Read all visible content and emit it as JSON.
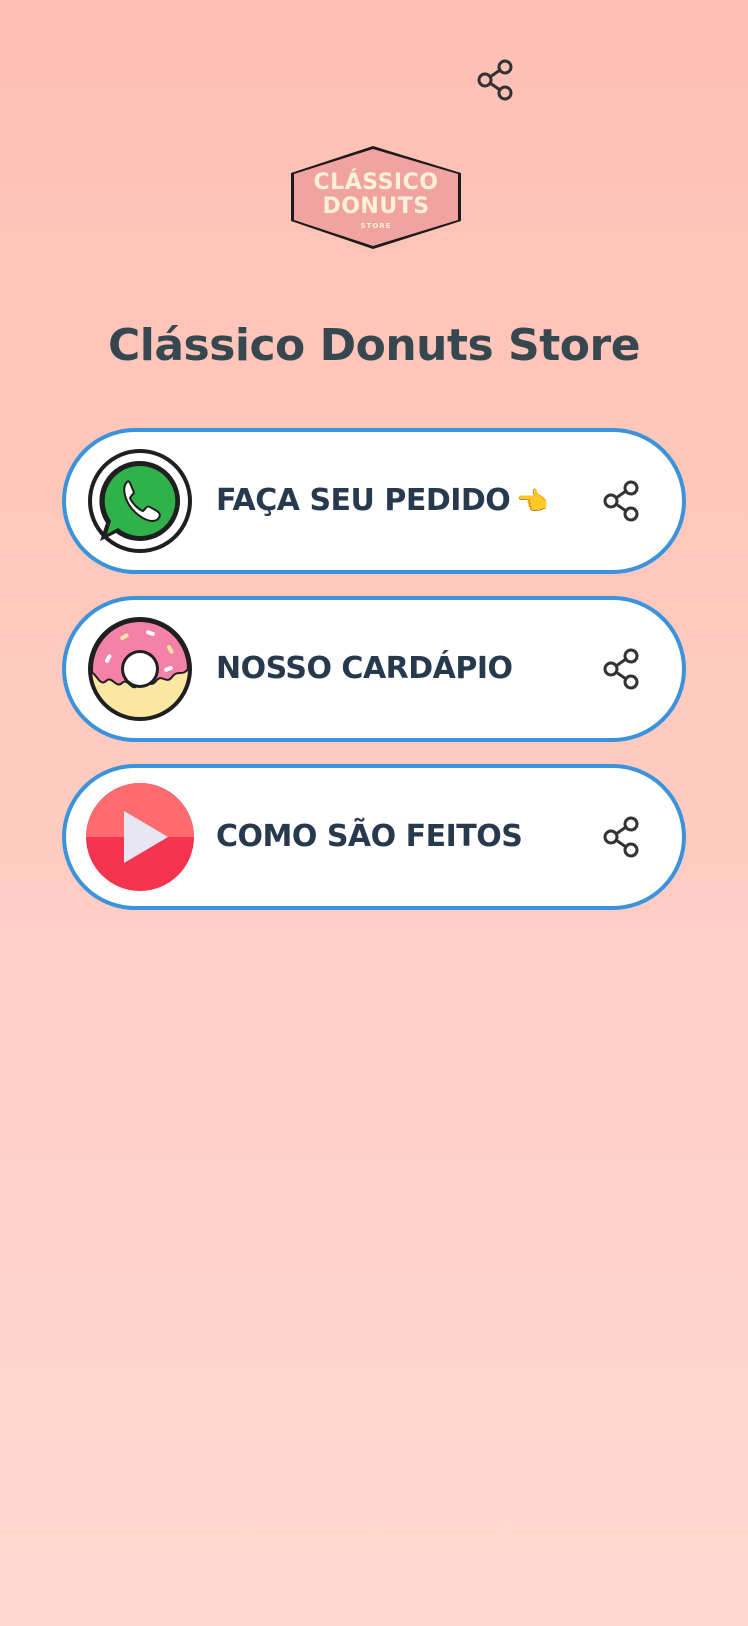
{
  "header": {
    "share_icon": "share-icon"
  },
  "logo": {
    "line1": "CLÁSSICO",
    "line2": "DONUTS",
    "line3": "STORE",
    "fill_color": "#f0a3a0",
    "text_color": "#fdf1dc"
  },
  "profile": {
    "title": "Clássico Donuts Store"
  },
  "links": [
    {
      "label": "FAÇA SEU PEDIDO",
      "emoji": "👈",
      "icon": "whatsapp-icon",
      "share_icon": "share-icon"
    },
    {
      "label": "NOSSO CARDÁPIO",
      "icon": "donut-icon",
      "share_icon": "share-icon"
    },
    {
      "label": "COMO SÃO FEITOS",
      "icon": "play-icon",
      "share_icon": "share-icon"
    }
  ],
  "colors": {
    "background_top": "#ffc0b4",
    "background_bottom": "#ffd9d0",
    "card_border": "#3b93db",
    "card_background": "#ffffff",
    "title_text": "#36474f",
    "label_text": "#26394d"
  }
}
